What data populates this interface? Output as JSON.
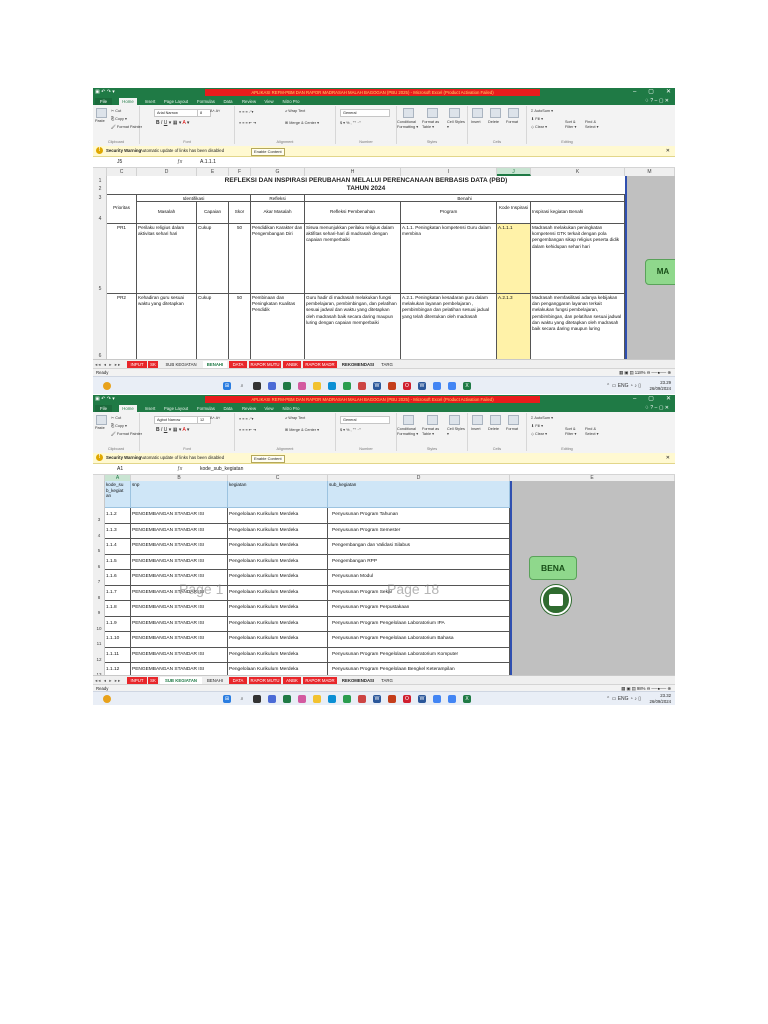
{
  "screens": [
    {
      "window_title": "APLIKASI REFM-PBM DAN RAPOR MADRASAH MALAH BAGOGAN (PBU 2025) - Microsoft Excel (Product Activation Failed)",
      "tabs": [
        "File",
        "Home",
        "Insert",
        "Page Layout",
        "Formulas",
        "Data",
        "Review",
        "View",
        "Nitro Pro"
      ],
      "ribbon": {
        "clipboard": {
          "paste": "Paste",
          "cut": "Cut",
          "copy": "Copy ▾",
          "format_painter": "Format Painter",
          "label": "Clipboard"
        },
        "font": {
          "name": "Arial Narrow",
          "size": "8",
          "label": "Font"
        },
        "alignment": {
          "wrap": "Wrap Text",
          "merge": "Merge & Center ▾",
          "label": "Alignment"
        },
        "number": {
          "format": "General",
          "label": "Number"
        },
        "styles": {
          "conditional": "Conditional Formatting ▾",
          "format_table": "Format as Table ▾",
          "cell_styles": "Cell Styles ▾",
          "label": "Styles"
        },
        "cells": {
          "insert": "Insert",
          "delete": "Delete",
          "format": "Format",
          "label": "Cells"
        },
        "editing": {
          "autosum": "AutoSum ▾",
          "fill": "Fill ▾",
          "clear": "Clear ▾",
          "sort": "Sort & Filter ▾",
          "find": "Find & Select ▾",
          "label": "Editing"
        }
      },
      "security": {
        "title": "Security Warning",
        "message": "Automatic update of links has been disabled",
        "button": "Enable Content"
      },
      "namebox": "J5",
      "formula": "A.1.1.1",
      "columns": [
        "C",
        "D",
        "E",
        "F",
        "G",
        "H",
        "I",
        "J",
        "K",
        "M"
      ],
      "selected_column": "J",
      "rows": [
        "1",
        "2",
        "3",
        "4",
        "5",
        "6"
      ],
      "title_line1": "REFLEKSI DAN INSPIRASI PERUBAHAN MELALUI PERENCANAAN BERBASIS DATA (PBD)",
      "title_line2": "TAHUN 2024",
      "group_headers": {
        "identifikasi": "Identifikasi",
        "refleksi": "Refleksi",
        "benahi": "Benahi"
      },
      "headers": {
        "prioritas": "Prioritas",
        "masalah": "Masalah",
        "capaian": "Capaian",
        "skor": "Skor",
        "akar": "Akar Masalah",
        "refleksi_pembenahan": "Refleksi Pembenahan",
        "program": "Program",
        "kode": "Kode Inspirasi",
        "inspirasi": "Inspirasi kegiatan Benahi"
      },
      "data_rows": [
        {
          "prioritas": "PR1",
          "masalah": "Perilaku religius dalam aktivitas sehari hari",
          "capaian": "Cukup",
          "skor": "50",
          "akar": "Pendidikan Karakter dan Pengembangan Diri",
          "refleksi": "Siswa menunjukkan perilaku religius dalam aktifitas sehari-hari di madrasah dengan capaian memperbaiki",
          "program": "A.1.1. Peningkatan kompetensi Guru dalam membina",
          "kode": "A.1.1.1",
          "inspirasi": "Madrasah melakukan peningkatan kompetensi GTK  terkait dengan pola pengembangan sikap religius peserta didik dalam kehidupan sehari hari"
        },
        {
          "prioritas": "PR2",
          "masalah": "Kehadiran guru sesuai waktu yang ditetapkan",
          "capaian": "Cukup",
          "skor": "50",
          "akar": "Pembinaan dan Peningkatan Kualitas Pendidik",
          "refleksi": "Guru hadir di madrasah melakukan fungsi pembelajaran, pembimbingan, dan pelatihan sesuai jadwal dan waktu yang ditetapkan oleh madrasah baik secara daring maupun luring dengan capaian memperbaiki",
          "program": "A.2.1. Peningkatan kesadaran guru dalam melakukan layanan pembelajaran , pembimbingan dan pelatihan sesuai jadual yang telah ditentukan oleh madrasah",
          "kode": "A.2.1.3",
          "inspirasi": "Madrasah memfasilitasi adanya kebijakan dan penganggaran layanan terkait melakukan fungsi pembelajaran, pembimbingan, dan pelatihan sesuai jadwal dan waktu yang ditetapkan oleh madrasah baik secara daring maupun luring"
        }
      ],
      "side_button": "MA",
      "sheet_tabs": [
        "INPUT",
        "SK",
        "SUB KEGIATAN",
        "BENAHI",
        "DATA",
        "RAPOR MUTU",
        "ANBK",
        "RAPOR MADR",
        "REKOMENDASI",
        "TARG"
      ],
      "active_sheet": "BENAHI",
      "status": "Ready",
      "zoom": "118%",
      "clock": {
        "time": "23.29",
        "date": "26/09/2024"
      },
      "lang": "ENG"
    },
    {
      "window_title": "APLIKASI REFM-PBM DAN RAPOR MADRASAH MALAH BAGOGAN (PBU 2025) - Microsoft Excel (Product Activation Failed)",
      "namebox": "A1",
      "formula": "kode_sub_kegiatan",
      "font_name": "Agbot Narrow",
      "font_size": "12",
      "columns": [
        "A",
        "B",
        "C",
        "D",
        "E"
      ],
      "headers": {
        "kode": "kode_su b_kegiat an",
        "snp": "snp",
        "kegiatan": "kegiatan",
        "sub": "sub_kegiatan"
      },
      "rows": [
        {
          "n": "3",
          "kode": "1.1.2",
          "snp": "PENGEMBANGAN STANDAR ISI",
          "kegiatan": "Pengelolaan Kurikulum Merdeka",
          "sub": "Penyusunan Program Tahunan"
        },
        {
          "n": "4",
          "kode": "1.1.3",
          "snp": "PENGEMBANGAN STANDAR ISI",
          "kegiatan": "Pengelolaan Kurikulum Merdeka",
          "sub": "Penyusunan Program Semester"
        },
        {
          "n": "5",
          "kode": "1.1.4",
          "snp": "PENGEMBANGAN STANDAR ISI",
          "kegiatan": "Pengelolaan Kurikulum Merdeka",
          "sub": "Pengembangan dan Validasi Silabus"
        },
        {
          "n": "6",
          "kode": "1.1.5",
          "snp": "PENGEMBANGAN STANDAR ISI",
          "kegiatan": "Pengelolaan Kurikulum Merdeka",
          "sub": "Pengembangan RPP"
        },
        {
          "n": "7",
          "kode": "1.1.6",
          "snp": "PENGEMBANGAN STANDAR ISI",
          "kegiatan": "Pengelolaan Kurikulum Merdeka",
          "sub": "Penyusunan Modul"
        },
        {
          "n": "8",
          "kode": "1.1.7",
          "snp": "PENGEMBANGAN STANDAR ISI",
          "kegiatan": "Pengelolaan Kurikulum Merdeka",
          "sub": "Penyusunan Program Sekar"
        },
        {
          "n": "9",
          "kode": "1.1.8",
          "snp": "PENGEMBANGAN STANDAR ISI",
          "kegiatan": "Pengelolaan Kurikulum Merdeka",
          "sub": "Penyusunan Program Perpustakaan"
        },
        {
          "n": "10",
          "kode": "1.1.9",
          "snp": "PENGEMBANGAN STANDAR ISI",
          "kegiatan": "Pengelolaan Kurikulum Merdeka",
          "sub": "Penyusunan Program Pengelolaan Laboratorium IPA"
        },
        {
          "n": "11",
          "kode": "1.1.10",
          "snp": "PENGEMBANGAN STANDAR ISI",
          "kegiatan": "Pengelolaan Kurikulum Merdeka",
          "sub": "Penyusunan Program Pengelolaan Laboratorium Bahasa"
        },
        {
          "n": "12",
          "kode": "1.1.11",
          "snp": "PENGEMBANGAN STANDAR ISI",
          "kegiatan": "Pengelolaan Kurikulum Merdeka",
          "sub": "Penyusunan Program Pengelolaan Laboratorium Komputer"
        },
        {
          "n": "13",
          "kode": "1.1.12",
          "snp": "PENGEMBANGAN STANDAR ISI",
          "kegiatan": "Pengelolaan Kurikulum Merdeka",
          "sub": "Penyusunan Program Pengelolaan Bengkel Keterampilan"
        }
      ],
      "side_button": "BENA",
      "watermark_left": "Page 1",
      "watermark_right": "Page 18",
      "sheet_tabs": [
        "INPUT",
        "SK",
        "SUB KEGIATAN",
        "BENAHI",
        "DATA",
        "RAPOR MUTU",
        "ANBK",
        "RAPOR MADR",
        "REKOMENDASI",
        "TARG"
      ],
      "active_sheet": "SUB KEGIATAN",
      "status": "Ready",
      "zoom": "98%",
      "clock": {
        "time": "23.32",
        "date": "26/09/2024"
      },
      "lang": "ENG"
    }
  ],
  "colors": {
    "excel_green": "#1f7a45",
    "banner_red": "#e81c1c",
    "highlight_yellow": "#fff2a8",
    "header_blue": "#cfe6f7",
    "button_green": "#8fd88c"
  }
}
